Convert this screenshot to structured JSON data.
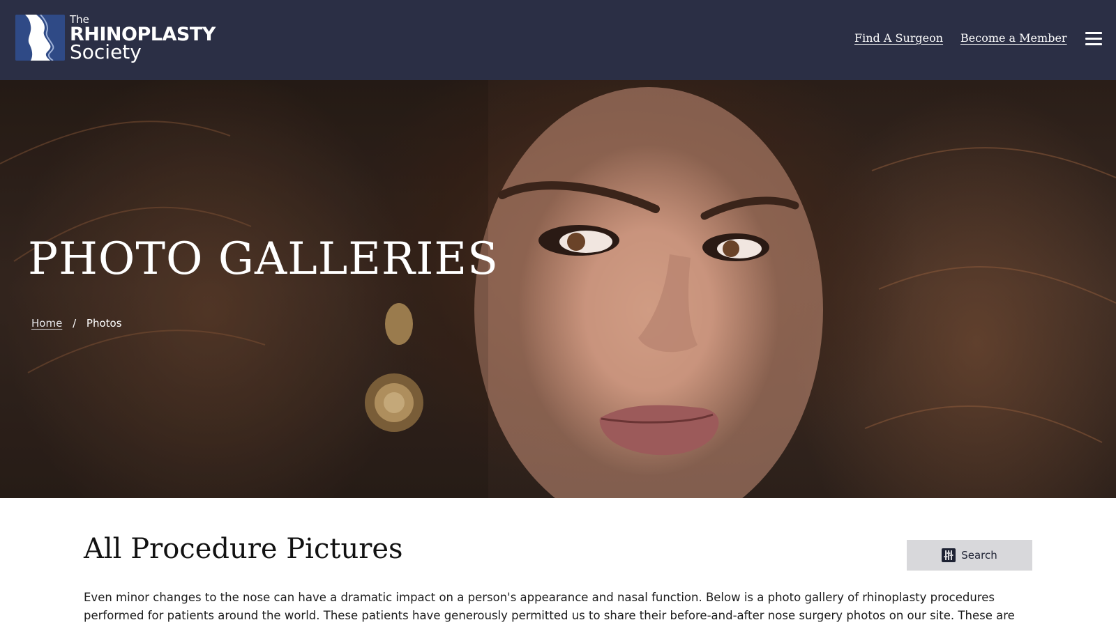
{
  "header": {
    "logo": {
      "the": "The",
      "name": "RHINOPLASTY",
      "society": "Society"
    },
    "nav": [
      {
        "label": "Find A Surgeon"
      },
      {
        "label": "Become a Member"
      }
    ],
    "menu_icon": "hamburger-menu-icon",
    "background": "#2b2f45"
  },
  "hero": {
    "title": "PHOTO GALLERIES",
    "breadcrumb": {
      "home": "Home",
      "separator": "/",
      "current": "Photos"
    }
  },
  "content": {
    "title": "All Procedure Pictures",
    "search_label": "Search",
    "search_icon": "filter-sliders-icon",
    "intro": "Even minor changes to the nose can have a dramatic impact on a person's appearance and nasal function. Below is a photo gallery of rhinoplasty procedures performed for patients around the world. These patients have generously permitted us to share their before-and-after nose surgery photos on our site. These are"
  }
}
